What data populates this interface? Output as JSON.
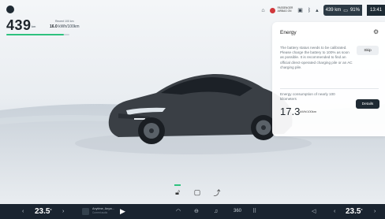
{
  "status": {
    "range_value": "439",
    "range_unit": "km",
    "efficiency_label": "Recent 100 km",
    "efficiency_value": "16.0",
    "efficiency_unit": "kWh/100km",
    "range_fraction": 0.91,
    "passenger_airbag_line1": "PASSENGER",
    "passenger_airbag_line2": "AIRBAG ON",
    "chip_range": "439 km",
    "battery_percent": "91%",
    "clock": "13:41"
  },
  "energy_panel": {
    "title": "Energy",
    "message": "The battery status needs to be calibrated. Please charge the battery to 100% as soon as possible. It is recommended to find an official direct-operated charging pile or an AC charging pile.",
    "skip_label": "Skip",
    "consumption_label": "Energy consumption of nearly 100 kilometers",
    "consumption_value": "17.3",
    "consumption_unit": "kWh/100km",
    "details_label": "Details"
  },
  "dock": {
    "driver_temp": "23.5",
    "passenger_temp": "23.5",
    "temp_unit": "°",
    "media_title": "Anytime, Anyw...",
    "media_sub": "Current audio",
    "icons": [
      "car-icon",
      "seat-icon",
      "music-icon",
      "camera-360-icon",
      "apps-icon",
      "volume-icon"
    ]
  },
  "colors": {
    "accent": "#2ec27e",
    "dock_bg": "#1a2430",
    "alert": "#d0373b"
  }
}
